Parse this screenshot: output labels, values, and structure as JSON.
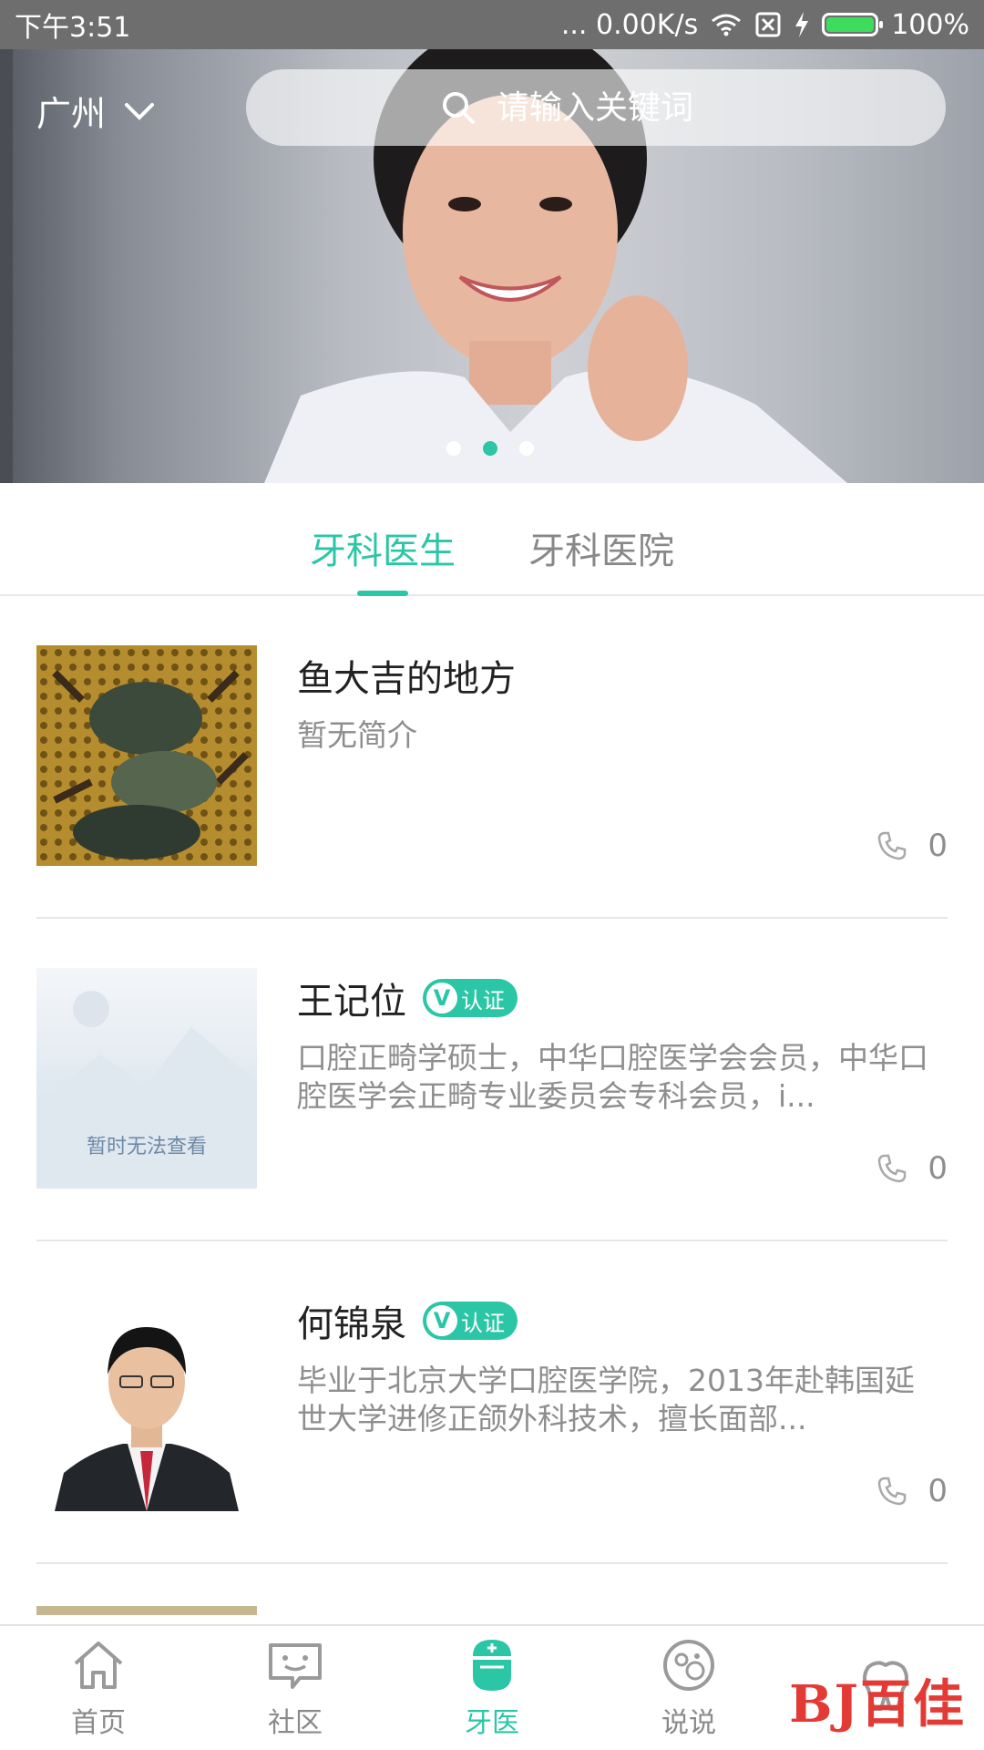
{
  "status_bar": {
    "time": "下午3:51",
    "network_speed": "... 0.00K/s",
    "battery_percent": "100%",
    "battery_level": 1.0
  },
  "header": {
    "city": "广州",
    "search_placeholder": "请输入关键词"
  },
  "banner": {
    "slide_count": 3,
    "active_slide": 2
  },
  "tabs": [
    {
      "label": "牙科医生",
      "active": true
    },
    {
      "label": "牙科医院",
      "active": false
    }
  ],
  "doctors": [
    {
      "name": "鱼大吉的地方",
      "verified": false,
      "description": "暂无简介",
      "call_count": "0"
    },
    {
      "name": "王记位",
      "verified": true,
      "badge_label": "认证",
      "badge_v": "V",
      "description": "口腔正畸学硕士，中华口腔医学会会员，中华口腔医学会正畸专业委员会专科会员，i...",
      "call_count": "0",
      "thumb_text": "暂时无法查看"
    },
    {
      "name": "何锦泉",
      "verified": true,
      "badge_label": "认证",
      "badge_v": "V",
      "description": "毕业于北京大学口腔医学院，2013年赴韩国延世大学进修正颌外科技术，擅长面部...",
      "call_count": "0"
    }
  ],
  "bottom_nav": [
    {
      "label": "首页",
      "icon": "home-icon",
      "active": false
    },
    {
      "label": "社区",
      "icon": "chat-bubble-icon",
      "active": false
    },
    {
      "label": "牙医",
      "icon": "dentist-icon",
      "active": true
    },
    {
      "label": "说说",
      "icon": "bubbles-icon",
      "active": false
    },
    {
      "label": "",
      "icon": "tooth-icon",
      "active": false
    }
  ],
  "watermark": "BJ百佳",
  "colors": {
    "accent": "#2bc6a6",
    "status_bar": "#6e6e6e",
    "text_primary": "#222222",
    "text_secondary": "#8e8e8e"
  }
}
